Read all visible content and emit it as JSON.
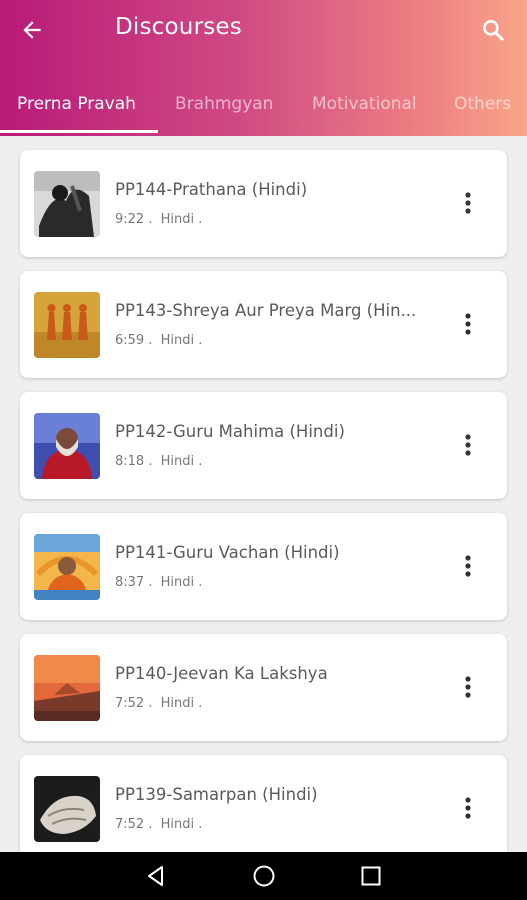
{
  "header": {
    "title": "Discourses",
    "back_icon": "arrow-left-icon",
    "search_icon": "search-icon",
    "gradient": [
      "#b81a78",
      "#f9a589"
    ]
  },
  "tabs": [
    {
      "label": "Prerna Pravah",
      "active": true
    },
    {
      "label": "Brahmgyan",
      "active": false
    },
    {
      "label": "Motivational",
      "active": false
    },
    {
      "label": "Others",
      "active": false
    }
  ],
  "items": [
    {
      "title": "PP144-Prathana (Hindi)",
      "duration": "9:22 .",
      "language": "Hindi ."
    },
    {
      "title": "PP143-Shreya Aur Preya Marg (Hin...",
      "duration": "6:59 .",
      "language": "Hindi ."
    },
    {
      "title": "PP142-Guru Mahima (Hindi)",
      "duration": "8:18 .",
      "language": "Hindi ."
    },
    {
      "title": "PP141-Guru Vachan (Hindi)",
      "duration": "8:37 .",
      "language": "Hindi ."
    },
    {
      "title": "PP140-Jeevan Ka Lakshya",
      "duration": "7:52 .",
      "language": "Hindi ."
    },
    {
      "title": "PP139-Samarpan (Hindi)",
      "duration": "7:52 .",
      "language": "Hindi ."
    }
  ],
  "navbar": {
    "back_icon": "nav-back-triangle-icon",
    "home_icon": "nav-home-circle-icon",
    "recents_icon": "nav-recents-square-icon"
  }
}
